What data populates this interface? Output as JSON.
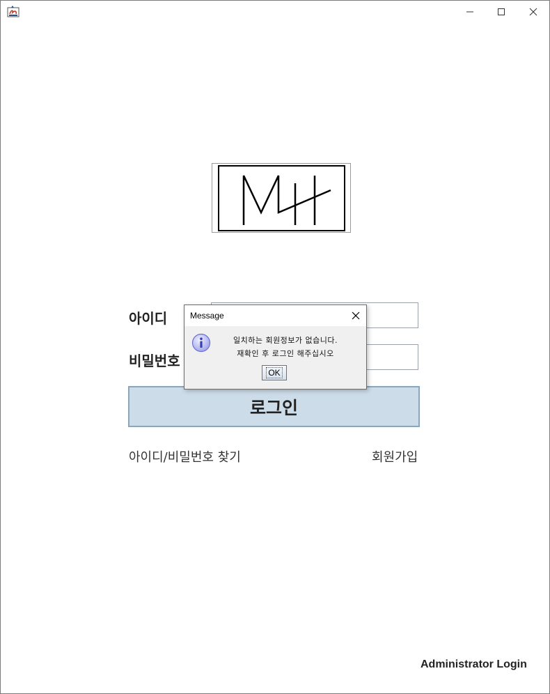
{
  "window": {
    "title": "",
    "controls": {
      "minimize": "minimize-icon",
      "maximize": "maximize-icon",
      "close": "close-icon"
    }
  },
  "logo": {
    "text": "MH"
  },
  "form": {
    "id_label": "아이디",
    "password_label": "비밀번호",
    "id_value": "",
    "password_value": "",
    "login_button": "로그인"
  },
  "links": {
    "find": "아이디/비밀번호 찾기",
    "signup": "회원가입",
    "admin": "Administrator Login"
  },
  "dialog": {
    "title": "Message",
    "icon": "info-icon",
    "message_line1": "일치하는 회원정보가 없습니다.",
    "message_line2": "재확인 후 로그인 해주십시오",
    "ok_button": "OK"
  },
  "colors": {
    "login_button_bg": "#ccdce8",
    "login_button_border": "#8aa6bd",
    "dialog_bg": "#f0f0f0",
    "info_icon": "#6b6fd6"
  }
}
